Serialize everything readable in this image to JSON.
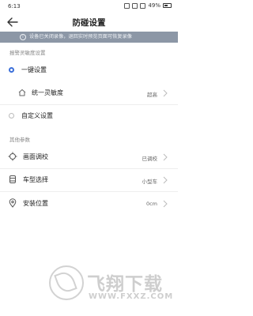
{
  "status_bar": {
    "time": "6:13",
    "battery": "49%"
  },
  "header": {
    "title": "防碰设置"
  },
  "notice": {
    "text": "设备已关闭录像，退回实时预览页面可恢复录像"
  },
  "sensitivity_section": {
    "title": "报警灵敏度设置",
    "one_key": {
      "label": "一键设置",
      "selected": true
    },
    "unified": {
      "label": "统一灵敏度",
      "value": "超高"
    },
    "custom": {
      "label": "自定义设置",
      "selected": false
    }
  },
  "other_section": {
    "title": "其他参数",
    "items": [
      {
        "label": "画面调校",
        "value": "已调校",
        "icon": "crosshair-icon"
      },
      {
        "label": "车型选择",
        "value": "小型车",
        "icon": "car-type-icon"
      },
      {
        "label": "安装位置",
        "value": "0cm",
        "icon": "location-pin-icon"
      }
    ]
  },
  "watermark": {
    "title": "飞翔下载",
    "url": "WWW.FXXZ.COM"
  },
  "colors": {
    "accent": "#3b6fd9",
    "notice_bg": "#8c97a6"
  }
}
